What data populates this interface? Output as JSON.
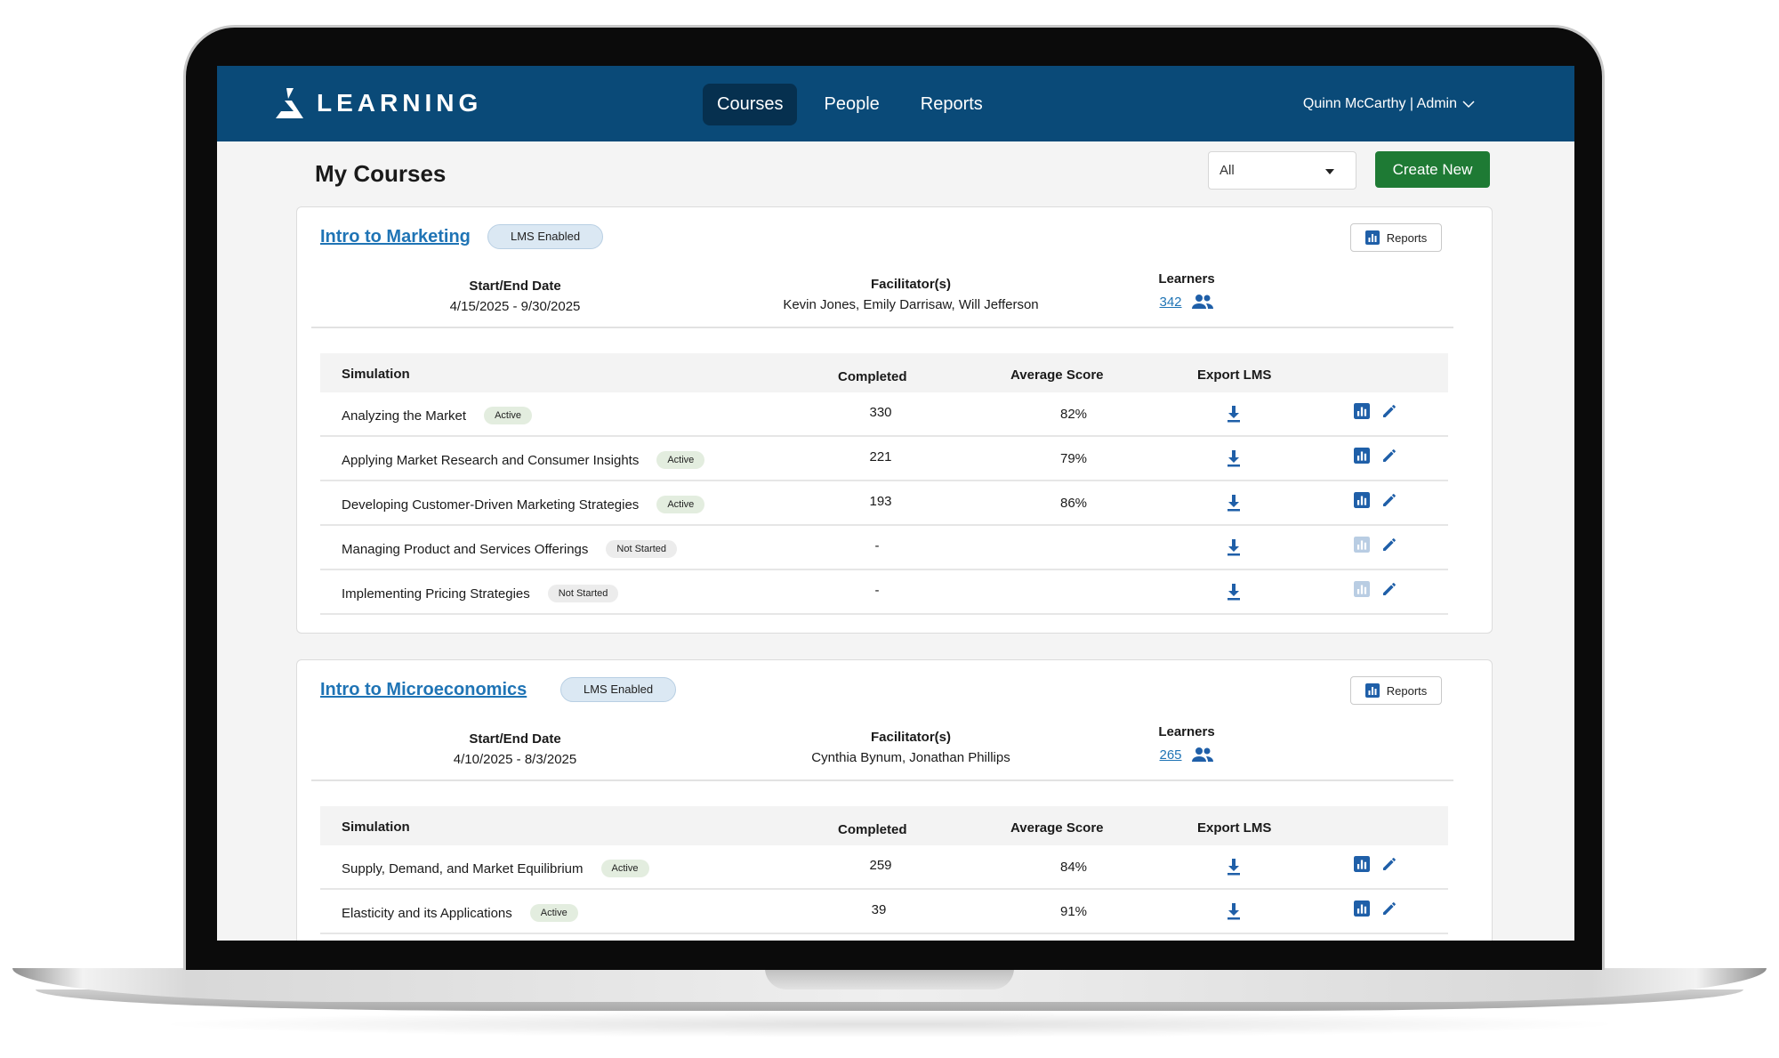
{
  "nav": {
    "logo_text": "LEARNING",
    "tabs": [
      {
        "label": "Courses",
        "active": true
      },
      {
        "label": "People",
        "active": false
      },
      {
        "label": "Reports",
        "active": false
      }
    ],
    "user_menu": "Quinn McCarthy | Admin"
  },
  "page": {
    "title": "My Courses",
    "filter_value": "All",
    "create_label": "Create New"
  },
  "columns": {
    "dates": "Start/End Date",
    "facilitators": "Facilitator(s)",
    "learners": "Learners",
    "simulation": "Simulation",
    "completed": "Completed",
    "avg_score": "Average Score",
    "export": "Export LMS"
  },
  "courses": [
    {
      "title": "Intro to Marketing",
      "badge": "LMS Enabled",
      "reports_label": "Reports",
      "dates": "4/15/2025 - 9/30/2025",
      "facilitators": "Kevin Jones, Emily Darrisaw, Will Jefferson",
      "learners": "342",
      "simulations": [
        {
          "name": "Analyzing the Market",
          "status": "Active",
          "completed": "330",
          "score": "82%"
        },
        {
          "name": "Applying Market Research and Consumer Insights",
          "status": "Active",
          "completed": "221",
          "score": "79%"
        },
        {
          "name": "Developing Customer-Driven Marketing Strategies",
          "status": "Active",
          "completed": "193",
          "score": "86%"
        },
        {
          "name": "Managing Product and Services Offerings",
          "status": "Not Started",
          "completed": "-",
          "score": ""
        },
        {
          "name": "Implementing Pricing Strategies",
          "status": "Not Started",
          "completed": "-",
          "score": ""
        }
      ]
    },
    {
      "title": "Intro to Microeconomics",
      "badge": "LMS Enabled",
      "reports_label": "Reports",
      "dates": "4/10/2025 - 8/3/2025",
      "facilitators": "Cynthia Bynum, Jonathan Phillips",
      "learners": "265",
      "simulations": [
        {
          "name": "Supply, Demand, and Market Equilibrium",
          "status": "Active",
          "completed": "259",
          "score": "84%"
        },
        {
          "name": "Elasticity and its Applications",
          "status": "Active",
          "completed": "39",
          "score": "91%"
        }
      ]
    }
  ],
  "colors": {
    "nav_bg": "#0a4a78",
    "nav_active": "#06304f",
    "primary_green": "#1e7a34",
    "link_blue": "#1f74b5",
    "icon_blue": "#1f5fa8"
  }
}
